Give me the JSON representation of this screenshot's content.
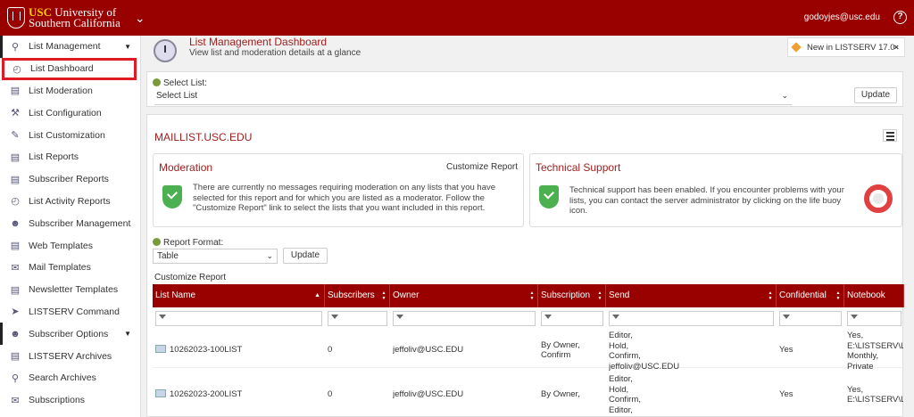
{
  "header": {
    "logo_abbr": "USC",
    "logo_line1": "University of",
    "logo_line2": "Southern California",
    "user_email": "godoyjes@usc.edu",
    "help_glyph": "?"
  },
  "sidebar": {
    "items": [
      {
        "label": "List Management",
        "icon": "pin-icon",
        "group": true
      },
      {
        "label": "List Dashboard",
        "icon": "clock-icon",
        "highlight": true
      },
      {
        "label": "List Moderation",
        "icon": "moderation-icon"
      },
      {
        "label": "List Configuration",
        "icon": "wrench-icon"
      },
      {
        "label": "List Customization",
        "icon": "pencil-icon"
      },
      {
        "label": "List Reports",
        "icon": "report-icon"
      },
      {
        "label": "Subscriber Reports",
        "icon": "subscriber-report-icon"
      },
      {
        "label": "List Activity Reports",
        "icon": "activity-icon"
      },
      {
        "label": "Subscriber Management",
        "icon": "users-icon"
      },
      {
        "label": "Web Templates",
        "icon": "web-template-icon"
      },
      {
        "label": "Mail Templates",
        "icon": "mail-template-icon"
      },
      {
        "label": "Newsletter Templates",
        "icon": "newsletter-icon"
      },
      {
        "label": "LISTSERV Command",
        "icon": "command-icon"
      },
      {
        "label": "Subscriber Options",
        "icon": "user-options-icon",
        "group": true
      },
      {
        "label": "LISTSERV Archives",
        "icon": "archives-icon"
      },
      {
        "label": "Search Archives",
        "icon": "search-icon"
      },
      {
        "label": "Subscriptions",
        "icon": "subscriptions-icon"
      }
    ]
  },
  "dashboard": {
    "title": "List Management Dashboard",
    "subtitle": "View list and moderation details at a glance",
    "new_in": "New in LISTSERV 17.0",
    "select_list_label": "Select List:",
    "select_list_value": "Select List",
    "update_label": "Update",
    "list_name": "MAILLIST.USC.EDU",
    "moderation": {
      "title": "Moderation",
      "customize_link": "Customize Report",
      "text": "There are currently no messages requiring moderation on any lists that you have selected for this report and for which you are listed as a moderator. Follow the \"Customize Report\" link to select the lists that you want included in this report."
    },
    "support": {
      "title": "Technical Support",
      "text": "Technical support has been enabled. If you encounter problems with your lists, you can contact the server administrator by clicking on the life buoy icon."
    },
    "report_format_label": "Report Format:",
    "report_format_value": "Table",
    "report_update_label": "Update",
    "customize_report": "Customize Report"
  },
  "table": {
    "columns": [
      "List Name",
      "Subscribers",
      "Owner",
      "Subscription",
      "Send",
      "Confidential",
      "Notebook"
    ],
    "rows": [
      {
        "list_name": "10262023-100LIST",
        "subscribers": "0",
        "owner": "jeffoliv@USC.EDU",
        "subscription": "By Owner,\nConfirm",
        "send": "Editor,\nHold,\nConfirm,\njeffoliv@USC.EDU",
        "confidential": "Yes",
        "notebook": "Yes,\nE:\\LISTSERV\\L\nMonthly,\nPrivate"
      },
      {
        "list_name": "10262023-200LIST",
        "subscribers": "0",
        "owner": "jeffoliv@USC.EDU",
        "subscription": "By Owner,",
        "send": "Editor,\nHold,\nConfirm,\nEditor,",
        "confidential": "Yes",
        "notebook": "Yes,\nE:\\LISTSERV\\L"
      }
    ]
  },
  "colors": {
    "brand": "#990000",
    "gold": "#ffcc00",
    "highlight_box": "#e01b24",
    "title_red": "#a02020",
    "shield_green": "#4caf50"
  }
}
